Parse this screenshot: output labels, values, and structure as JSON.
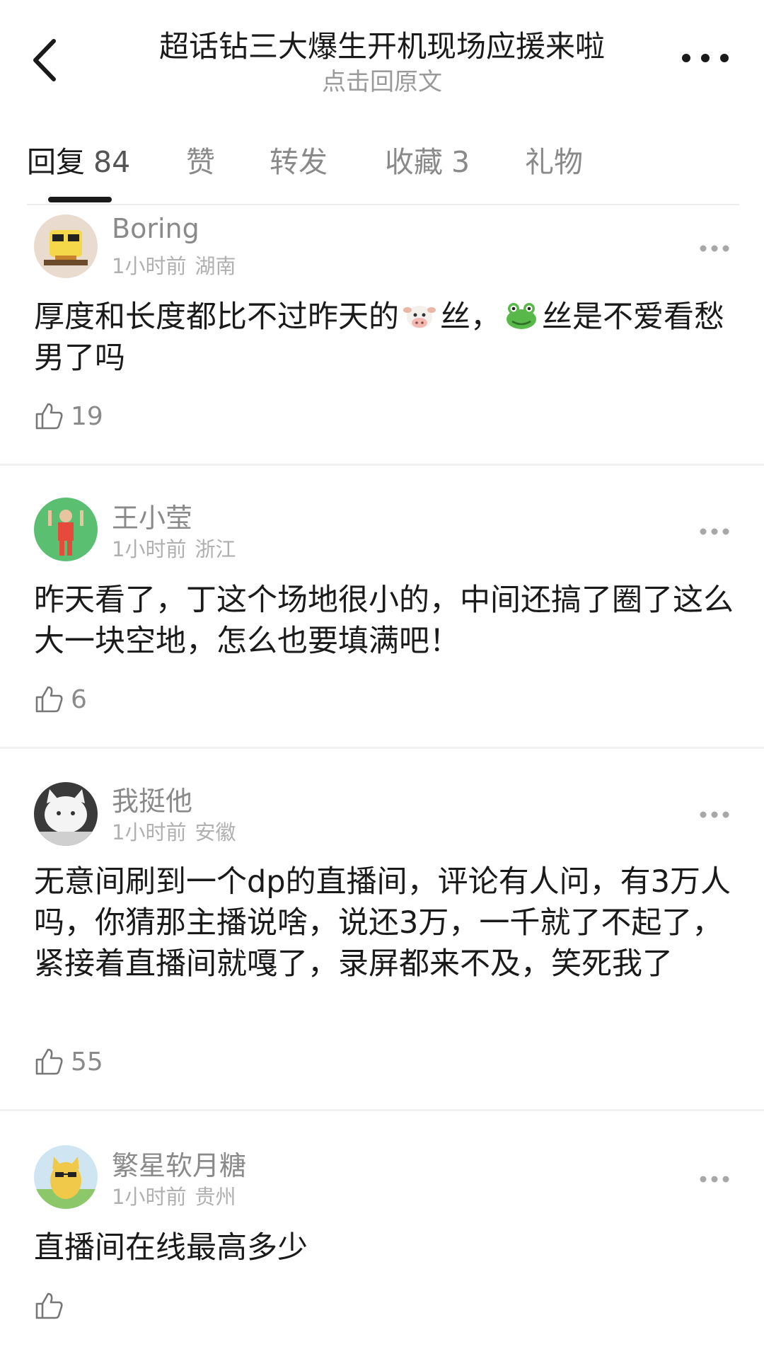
{
  "header": {
    "title": "超话钻三大爆生开机现场应援来啦",
    "subtitle": "点击回原文"
  },
  "tabs": [
    {
      "label": "回复",
      "count": "84",
      "active": true
    },
    {
      "label": "赞",
      "count": "",
      "active": false
    },
    {
      "label": "转发",
      "count": "",
      "active": false
    },
    {
      "label": "收藏",
      "count": "3",
      "active": false
    },
    {
      "label": "礼物",
      "count": "",
      "active": false
    }
  ],
  "comments": [
    {
      "username": "Boring",
      "time": "1小时前",
      "location": "湖南",
      "text_part1": "厚度和长度都比不过昨天的",
      "emoji1": "cow-face",
      "text_part2": "丝，",
      "emoji2": "frog-face",
      "text_part3": "丝是不爱看愁男了吗",
      "likes": "19"
    },
    {
      "username": "王小莹",
      "time": "1小时前",
      "location": "浙江",
      "text": "昨天看了，丁这个场地很小的，中间还搞了圈了这么大一块空地，怎么也要填满吧！",
      "likes": "6"
    },
    {
      "username": "我挺他",
      "time": "1小时前",
      "location": "安徽",
      "text": "无意间刷到一个dp的直播间，评论有人问，有3万人吗，你猜那主播说啥，说还3万，一千就了不起了，紧接着直播间就嘎了，录屏都来不及，笑死我了",
      "likes": "55"
    },
    {
      "username": "繁星软月糖",
      "time": "1小时前",
      "location": "贵州",
      "text": "直播间在线最高多少",
      "likes": ""
    }
  ],
  "colors": {
    "text_primary": "#1a1a1a",
    "text_secondary": "#8a8a8a",
    "divider": "#f1f1f1"
  }
}
